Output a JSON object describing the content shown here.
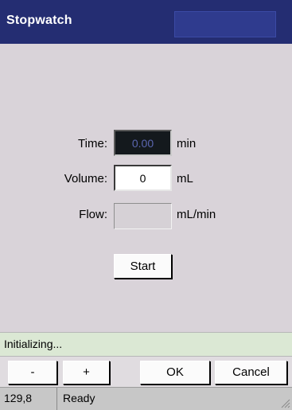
{
  "window": {
    "title": "Stopwatch"
  },
  "form": {
    "time": {
      "label": "Time:",
      "value": "0.00",
      "unit": "min"
    },
    "volume": {
      "label": "Volume:",
      "value": "0",
      "unit": "mL"
    },
    "flow": {
      "label": "Flow:",
      "value": "",
      "unit": "mL/min"
    },
    "start_label": "Start"
  },
  "message": "Initializing...",
  "buttons": {
    "minus": "-",
    "plus": "+",
    "ok": "OK",
    "cancel": "Cancel"
  },
  "statusbar": {
    "position": "129,8",
    "state": "Ready"
  },
  "colors": {
    "titlebar": "#242d72",
    "background": "#d9d3d9",
    "message_bg": "#dbe8d4"
  }
}
